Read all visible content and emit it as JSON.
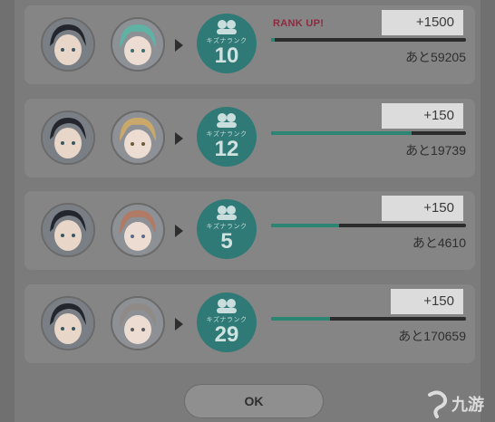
{
  "rows": [
    {
      "rank_label": "キズナランク",
      "rank": "10",
      "rank_up": "RANK UP!",
      "points": "+1500",
      "remaining": "あと59205",
      "progress": 0.02,
      "partner_hair": "#5fb3a5"
    },
    {
      "rank_label": "キズナランク",
      "rank": "12",
      "rank_up": "",
      "points": "+150",
      "remaining": "あと19739",
      "progress": 0.72,
      "partner_hair": "#c9a86a"
    },
    {
      "rank_label": "キズナランク",
      "rank": "5",
      "rank_up": "",
      "points": "+150",
      "remaining": "あと4610",
      "progress": 0.35,
      "partner_hair": "#b07a64"
    },
    {
      "rank_label": "キズナランク",
      "rank": "29",
      "rank_up": "",
      "points": "+150",
      "remaining": "あと170659",
      "progress": 0.3,
      "partner_hair": "#8f8a86"
    }
  ],
  "ok_button": {
    "label": "OK"
  },
  "watermark": {
    "text": "九游"
  },
  "colors": {
    "accent": "#2a8573",
    "badge": "#2f7a76",
    "rank_up": "#8e2a40"
  }
}
